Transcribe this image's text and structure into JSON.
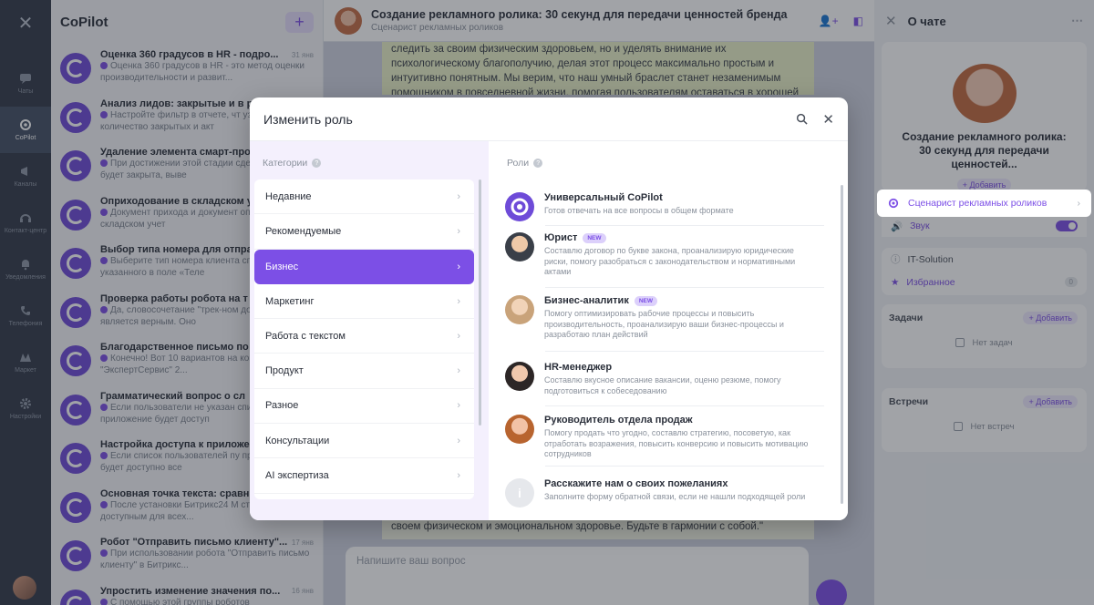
{
  "nav": {
    "items": [
      {
        "label": "Чаты",
        "icon": "chat-icon"
      },
      {
        "label": "CoPilot",
        "icon": "copilot-icon",
        "active": true
      },
      {
        "label": "Каналы",
        "icon": "megaphone-icon"
      },
      {
        "label": "Контакт-центр",
        "icon": "contact-center-icon"
      },
      {
        "label": "Уведомления",
        "icon": "bell-icon"
      },
      {
        "label": "Телефония",
        "icon": "phone-icon"
      },
      {
        "label": "Маркет",
        "icon": "market-icon"
      },
      {
        "label": "Настройки",
        "icon": "gear-icon"
      }
    ]
  },
  "chatlist": {
    "title": "CoPilot",
    "add": "+",
    "items": [
      {
        "name": "Оценка 360 градусов в HR - подро...",
        "date": "31 янв",
        "preview": "Оценка 360 градусов в HR - это метод оценки производительности и развит..."
      },
      {
        "name": "Анализ лидов: закрытые и в р",
        "date": "",
        "preview": "Настройте фильтр в отчете, чт узнать количество закрытых и акт"
      },
      {
        "name": "Удаление элемента смарт-про",
        "date": "",
        "preview": "При достижении этой стадии сделки, деал будет закрыта, выве"
      },
      {
        "name": "Оприходование в складском у",
        "date": "",
        "preview": "Документ прихода и документ оприходования в складском учет"
      },
      {
        "name": "Выбор типа номера для отпра",
        "date": "",
        "preview": "Выберите тип номера клиента списка, указанного в поле «Теле"
      },
      {
        "name": "Проверка работы робота на т",
        "date": "",
        "preview": "Да, словосочетание \"трек-ном доставки\" является верным. Оно"
      },
      {
        "name": "Благодарственное письмо по",
        "date": "",
        "preview": "Конечно! Вот 10 вариантов на компании: 1. \"ЭкспертСервис\" 2..."
      },
      {
        "name": "Грамматический вопрос о сл",
        "date": "",
        "preview": "Если пользователи не указан списке, приложение будет доступ"
      },
      {
        "name": "Настройка доступа к приложе",
        "date": "",
        "preview": "Если список пользователей пу приложение будет доступно все"
      },
      {
        "name": "Основная точка текста: сравн",
        "date": "",
        "preview": "После установки Битрикс24 M становится доступным для всех..."
      },
      {
        "name": "Робот \"Отправить письмо клиенту\"...",
        "date": "17 янв",
        "preview": "При использовании робота \"Отправить письмо клиенту\" в Битрикс..."
      },
      {
        "name": "Упростить изменение значения по...",
        "date": "16 янв",
        "preview": "С помощью этой группы роботов"
      }
    ]
  },
  "chat": {
    "title": "Создание рекламного ролика: 30 секунд для передачи ценностей бренда",
    "subtitle": "Сценарист рекламных роликов",
    "message_top": "следить за своим физическим здоровьем, но и уделять внимание их психологическому благополучию, делая этот процесс максимально простым и интуитивно понятным. Мы верим, что наш умный браслет станет незаменимым помощником в повседневной жизни, помогая пользователям оставаться в хорошей",
    "message_bottom": "своем физическом и эмоциональном здоровье. Будьте в гармонии с собой.\"",
    "input_placeholder": "Напишите ваш вопрос"
  },
  "info": {
    "title": "О чате",
    "chat_name": "Создание рекламного ролика: 30 секунд для передачи ценностей...",
    "add_label": "+ Добавить",
    "role_label": "Сценарист рекламных роликов",
    "sound_label": "Звук",
    "company": "IT-Solution",
    "favorites": "Избранное",
    "favorites_count": "0",
    "tasks_title": "Задачи",
    "tasks_add": "+ Добавить",
    "tasks_empty": "Нет задач",
    "meetings_title": "Встречи",
    "meetings_add": "+ Добавить",
    "meetings_empty": "Нет встреч"
  },
  "modal": {
    "title": "Изменить роль",
    "categories_label": "Категории",
    "roles_label": "Роли",
    "categories": [
      {
        "label": "Недавние"
      },
      {
        "label": "Рекомендуемые"
      },
      {
        "label": "Бизнес",
        "active": true
      },
      {
        "label": "Маркетинг"
      },
      {
        "label": "Работа с текстом"
      },
      {
        "label": "Продукт"
      },
      {
        "label": "Разное"
      },
      {
        "label": "Консультации"
      },
      {
        "label": "AI экспертиза"
      }
    ],
    "roles": [
      {
        "name": "Универсальный CoPilot",
        "desc": "Готов отвечать на все вопросы в общем формате",
        "badge": ""
      },
      {
        "name": "Юрист",
        "desc": "Составлю договор по букве закона, проанализирую юридические риски, помогу разобраться с законодательством и нормативными актами",
        "badge": "NEW"
      },
      {
        "name": "Бизнес-аналитик",
        "desc": "Помогу оптимизировать рабочие процессы и повысить производительность, проанализирую ваши бизнес-процессы и разработаю план действий",
        "badge": "NEW"
      },
      {
        "name": "HR-менеджер",
        "desc": "Составлю вкусное описание вакансии, оценю резюме, помогу подготовиться к собеседованию",
        "badge": ""
      },
      {
        "name": "Руководитель отдела продаж",
        "desc": "Помогу продать что угодно, составлю стратегию, посоветую, как отработать возражения, повысить конверсию и повысить мотивацию сотрудников",
        "badge": ""
      },
      {
        "name": "Расскажите нам о своих пожеланиях",
        "desc": "Заполните форму обратной связи, если не нашли подходящей роли",
        "badge": ""
      }
    ]
  },
  "colors": {
    "accent": "#7c4fe6",
    "nav": "#323a49"
  }
}
